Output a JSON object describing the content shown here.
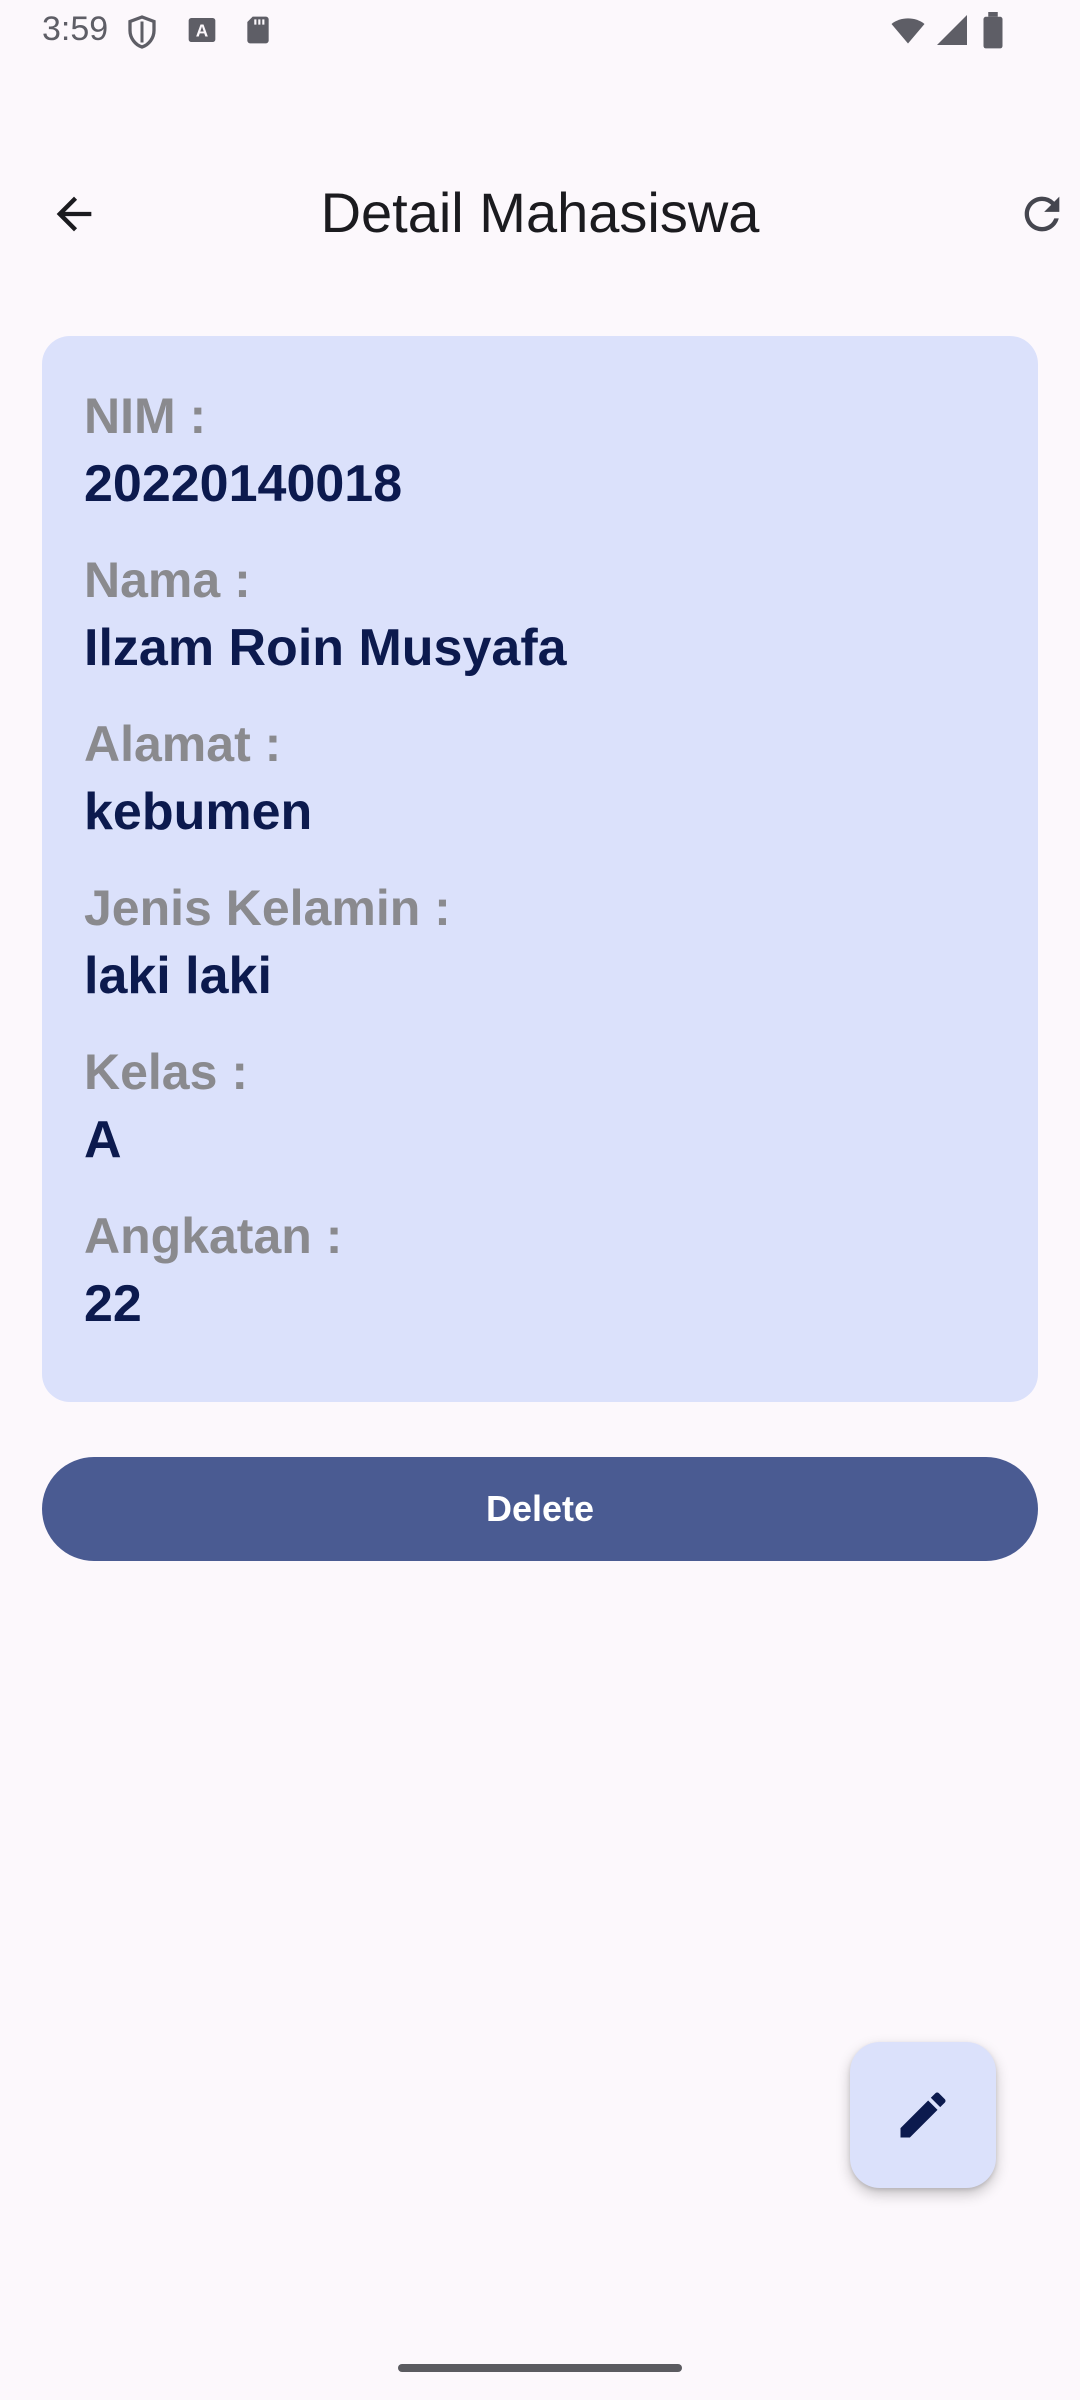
{
  "status_bar": {
    "time": "3:59",
    "left_icons": [
      "shield-icon",
      "keyboard-a-icon",
      "sd-card-icon"
    ],
    "right_icons": [
      "wifi-icon",
      "signal-icon",
      "battery-icon"
    ]
  },
  "app_bar": {
    "title": "Detail Mahasiswa",
    "back_icon": "arrow-back-icon",
    "refresh_icon": "refresh-icon"
  },
  "detail": {
    "fields": [
      {
        "label": "NIM :",
        "value": "20220140018"
      },
      {
        "label": "Nama :",
        "value": "Ilzam Roin Musyafa"
      },
      {
        "label": "Alamat :",
        "value": "kebumen"
      },
      {
        "label": "Jenis Kelamin :",
        "value": "laki laki"
      },
      {
        "label": "Kelas :",
        "value": "A"
      },
      {
        "label": "Angkatan :",
        "value": "22"
      }
    ]
  },
  "actions": {
    "delete_label": "Delete",
    "edit_icon": "edit-icon"
  },
  "colors": {
    "background": "#FCF8FC",
    "card": "#DBE1FB",
    "primary": "#4A5B92",
    "label": "#8A8A8E",
    "value": "#0C1A4E"
  }
}
